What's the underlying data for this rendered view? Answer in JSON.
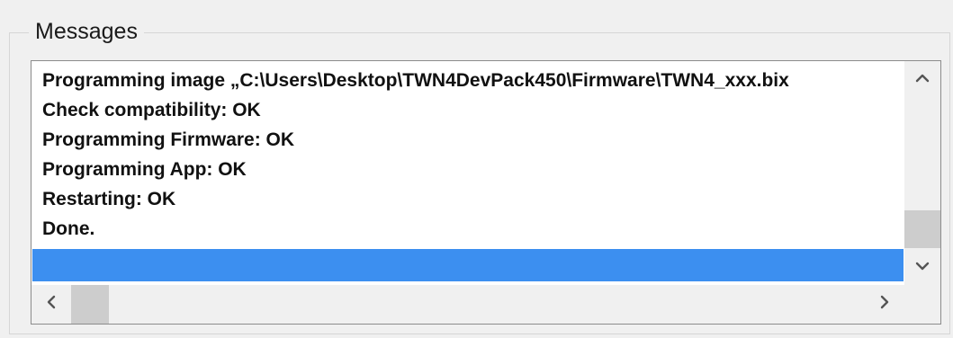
{
  "groupbox": {
    "title": "Messages"
  },
  "messages": {
    "lines": [
      "Programming image „C:\\Users\\Desktop\\TWN4DevPack450\\Firmware\\TWN4_xxx.bix",
      "Check compatibility: OK",
      "Programming Firmware: OK",
      "Programming App: OK",
      "Restarting: OK",
      "Done."
    ],
    "selected_line": ""
  },
  "scrollbars": {
    "vertical_icons": [
      "chevron-up-icon",
      "chevron-down-icon"
    ],
    "horizontal_icons": [
      "chevron-left-icon",
      "chevron-right-icon"
    ],
    "vertical_position": 0.85,
    "horizontal_position": 0.0
  },
  "colors": {
    "selection": "#3c8ff0",
    "thumb": "#cdcdcd",
    "background": "#f0f0f0"
  }
}
